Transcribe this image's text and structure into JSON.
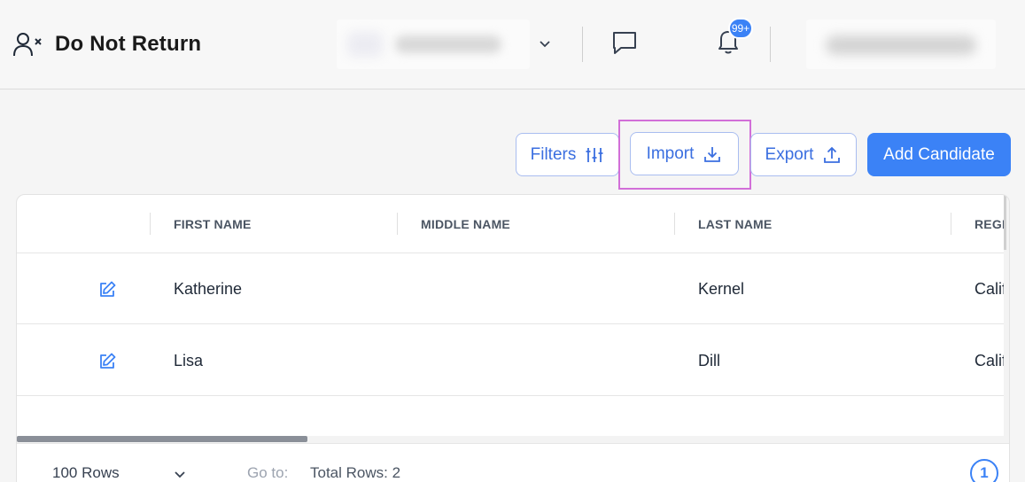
{
  "header": {
    "title": "Do Not Return",
    "notification_badge": "99+"
  },
  "toolbar": {
    "filters_label": "Filters",
    "import_label": "Import",
    "export_label": "Export",
    "add_label": "Add Candidate"
  },
  "table": {
    "columns": [
      "FIRST NAME",
      "MIDDLE NAME",
      "LAST NAME",
      "REGI"
    ],
    "rows": [
      {
        "first": "Katherine",
        "middle": "",
        "last": "Kernel",
        "region": "Calif"
      },
      {
        "first": "Lisa",
        "middle": "",
        "last": "Dill",
        "region": "Calif"
      }
    ]
  },
  "footer": {
    "rows_per_page": "100 Rows",
    "goto_label": "Go to:",
    "total_rows": "Total Rows: 2",
    "current_page": "1"
  },
  "colors": {
    "accent": "#3b82f6",
    "highlight": "#d26fd8"
  }
}
